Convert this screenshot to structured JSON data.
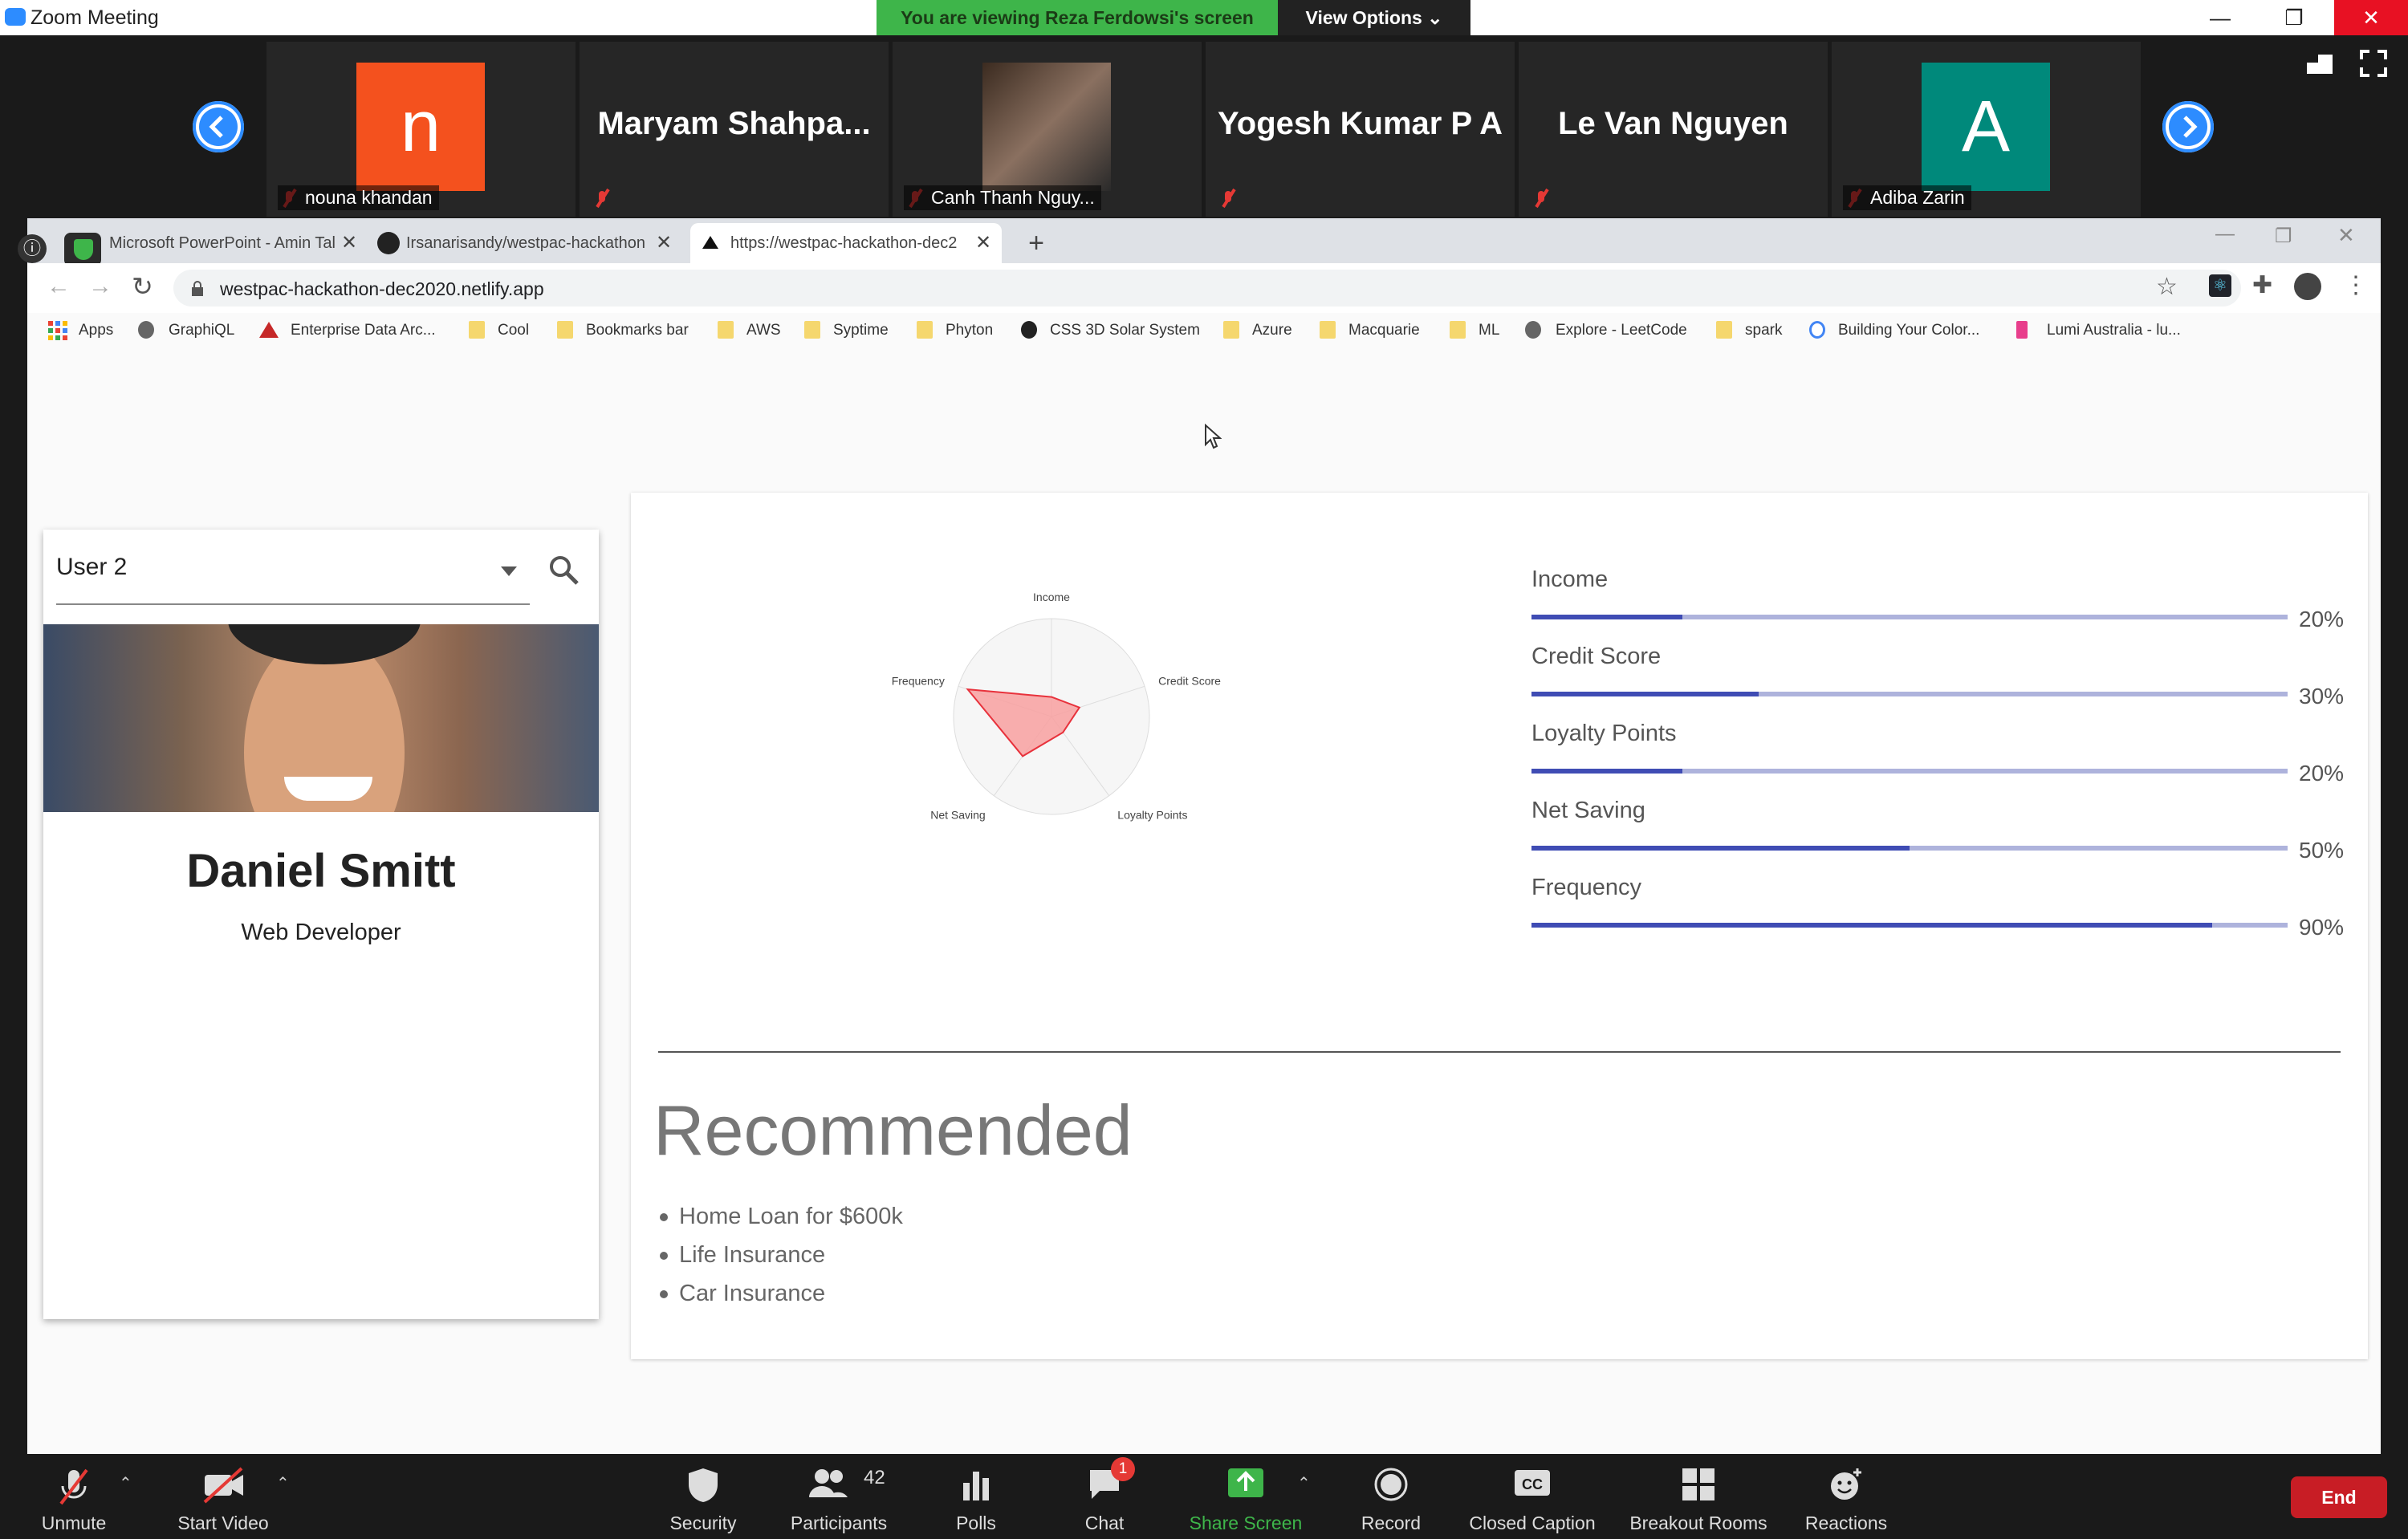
{
  "zoom": {
    "app_title": "Zoom Meeting",
    "viewing_banner": "You are viewing Reza Ferdowsi's screen",
    "view_options": "View Options",
    "participants": [
      {
        "name": "nouna khandan",
        "avatar_letter": "n",
        "avatar_color": "#f4511e"
      },
      {
        "name": "Maryam  Shahpa..."
      },
      {
        "name": "Canh Thanh Nguy..."
      },
      {
        "name": "Yogesh Kumar P A"
      },
      {
        "name": "Le Van Nguyen"
      },
      {
        "name": "Adiba Zarin",
        "avatar_letter": "A",
        "avatar_color": "#00897b"
      }
    ],
    "controls": {
      "unmute": "Unmute",
      "start_video": "Start Video",
      "security": "Security",
      "participants": "Participants",
      "participants_count": "42",
      "polls": "Polls",
      "chat": "Chat",
      "chat_badge": "1",
      "share_screen": "Share Screen",
      "record": "Record",
      "closed_caption": "Closed Caption",
      "breakout_rooms": "Breakout Rooms",
      "reactions": "Reactions",
      "end": "End"
    }
  },
  "browser": {
    "tabs": [
      {
        "title": "Microsoft PowerPoint - Amin Tal"
      },
      {
        "title": "Irsanarisandy/westpac-hackathon"
      },
      {
        "title": "https://westpac-hackathon-dec2"
      }
    ],
    "url": "westpac-hackathon-dec2020.netlify.app",
    "bookmarks": [
      "Apps",
      "GraphiQL",
      "Enterprise Data Arc...",
      "Cool",
      "Bookmarks bar",
      "AWS",
      "Syptime",
      "Phyton",
      "CSS 3D Solar System",
      "Azure",
      "Macquarie",
      "ML",
      "Explore - LeetCode",
      "spark",
      "Building Your Color...",
      "Lumi Australia - lu..."
    ]
  },
  "page": {
    "user_select": "User 2",
    "person_name": "Daniel Smitt",
    "person_title": "Web Developer",
    "bars": [
      {
        "label": "Income",
        "pct_text": "20%",
        "value": 0.2
      },
      {
        "label": "Credit Score",
        "pct_text": "30%",
        "value": 0.3
      },
      {
        "label": "Loyalty Points",
        "pct_text": "20%",
        "value": 0.2
      },
      {
        "label": "Net Saving",
        "pct_text": "50%",
        "value": 0.5
      },
      {
        "label": "Frequency",
        "pct_text": "90%",
        "value": 0.9
      }
    ],
    "recommended_title": "Recommended",
    "recommendations": [
      "Home Loan for $600k",
      "Life Insurance",
      "Car Insurance"
    ]
  },
  "chart_data": {
    "type": "radar",
    "categories": [
      "Income",
      "Credit Score",
      "Loyalty Points",
      "Net Saving",
      "Frequency"
    ],
    "values": [
      0.2,
      0.3,
      0.2,
      0.5,
      0.9
    ],
    "fill_color": "#f8a0a0",
    "stroke_color": "#e8323c"
  }
}
